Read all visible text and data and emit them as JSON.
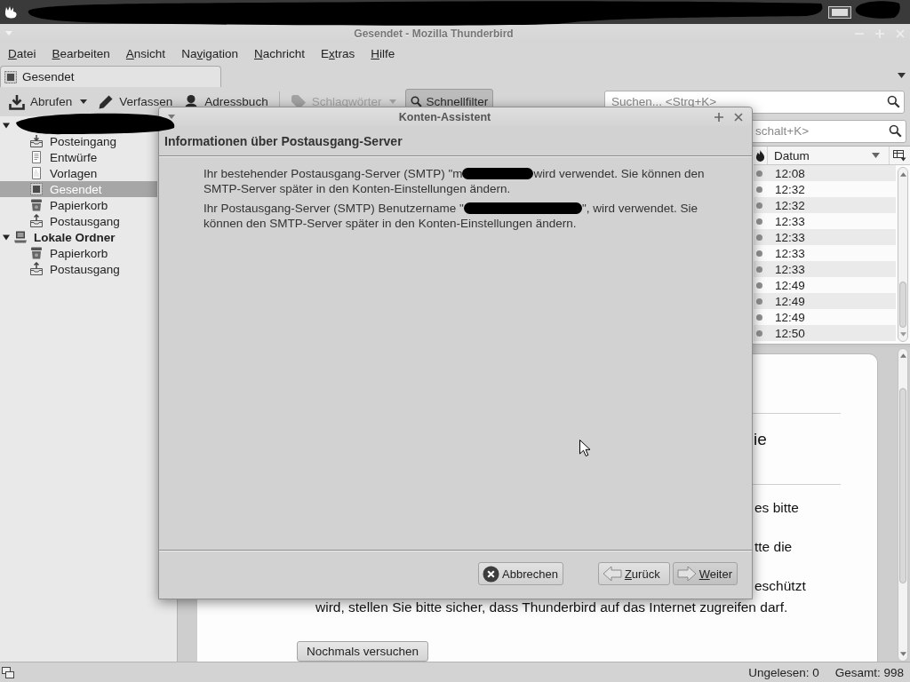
{
  "window": {
    "title": "Gesendet - Mozilla Thunderbird"
  },
  "menu": [
    {
      "key": "D",
      "post": "atei"
    },
    {
      "key": "B",
      "post": "earbeiten"
    },
    {
      "key": "A",
      "post": "nsicht"
    },
    {
      "pre": "Na",
      "key": "v",
      "post": "igation"
    },
    {
      "key": "N",
      "post": "achricht"
    },
    {
      "pre": "E",
      "key": "x",
      "post": "tras"
    },
    {
      "key": "H",
      "post": "ilfe"
    }
  ],
  "tabs": [
    {
      "label": "Gesendet",
      "selected": true
    }
  ],
  "toolbar": {
    "main": [
      {
        "kind": "download",
        "label": "Abrufen",
        "dropdown": true,
        "disabled": false,
        "pressed": false
      },
      {
        "kind": "pencil",
        "label": "Verfassen",
        "dropdown": false,
        "disabled": false,
        "pressed": false
      },
      {
        "kind": "person",
        "label": "Adressbuch",
        "dropdown": false,
        "disabled": false,
        "pressed": false
      }
    ],
    "filters": [
      {
        "kind": "tag",
        "label": "Schlagwörter",
        "dropdown": true,
        "disabled": true,
        "pressed": false
      },
      {
        "kind": "search",
        "label": "Schnellfilter",
        "dropdown": false,
        "disabled": false,
        "pressed": true
      }
    ],
    "search": {
      "placeholder": "Suchen... <Strg+K>"
    }
  },
  "folders": [
    {
      "kind": "account",
      "expanded": true,
      "selected": false,
      "children": [
        {
          "name": "Posteingang",
          "kind": "inbox",
          "selected": false
        },
        {
          "name": "Entwürfe",
          "kind": "drafts",
          "selected": false
        },
        {
          "name": "Vorlagen",
          "kind": "templates",
          "selected": false
        },
        {
          "name": "Gesendet",
          "kind": "sent",
          "selected": true
        },
        {
          "name": "Papierkorb",
          "kind": "trash",
          "selected": false
        },
        {
          "name": "Postausgang",
          "kind": "outbox",
          "selected": false
        }
      ]
    },
    {
      "kind": "local",
      "name": "Lokale Ordner",
      "expanded": true,
      "selected": false,
      "children": [
        {
          "name": "Papierkorb",
          "kind": "trash",
          "selected": false
        },
        {
          "name": "Postausgang",
          "kind": "outbox",
          "selected": false
        }
      ]
    }
  ],
  "quick_filter": {
    "search": {
      "placeholder": "schalt+K>"
    }
  },
  "message_list": {
    "date_column": {
      "label": "Datum",
      "sorted": true
    },
    "rows": [
      {
        "date": "12:08",
        "read": true,
        "selected": false
      },
      {
        "date": "12:32",
        "read": true,
        "selected": false
      },
      {
        "date": "12:32",
        "read": true,
        "selected": false
      },
      {
        "date": "12:33",
        "read": true,
        "selected": false
      },
      {
        "date": "12:33",
        "read": true,
        "selected": false
      },
      {
        "date": "12:33",
        "read": true,
        "selected": false
      },
      {
        "date": "12:33",
        "read": true,
        "selected": false
      },
      {
        "date": "12:49",
        "read": true,
        "selected": false
      },
      {
        "date": "12:49",
        "read": true,
        "selected": false
      },
      {
        "date": "12:49",
        "read": true,
        "selected": false
      },
      {
        "date": "12:50",
        "read": true,
        "selected": false
      }
    ]
  },
  "preview": {
    "blocks": [
      {
        "kind": "rule"
      },
      {
        "kind": "heading",
        "text": "ie"
      },
      {
        "kind": "rule"
      },
      {
        "kind": "fragment",
        "text": "es bitte"
      },
      {
        "kind": "fragment",
        "text": "tte die"
      },
      {
        "kind": "fragment",
        "text": "eschützt"
      },
      {
        "kind": "line",
        "text": "wird, stellen Sie bitte sicher, dass Thunderbird auf das Internet zugreifen darf."
      },
      {
        "kind": "button",
        "text": "Nochmals versuchen"
      }
    ]
  },
  "status_bar": {
    "unread": "Ungelesen: 0",
    "total": "Gesamt: 998"
  },
  "dialog": {
    "title": "Konten-Assistent",
    "heading": "Informationen über Postausgang-Server",
    "paragraphs": [
      [
        [
          {
            "kind": "text",
            "text": "Ihr bestehender Postausgang-Server (SMTP) \"m"
          },
          {
            "kind": "redaction"
          },
          {
            "kind": "text",
            "text": "wird verwendet. Sie können den"
          }
        ],
        [
          {
            "kind": "text",
            "text": "SMTP-Server später in den Konten-Einstellungen ändern."
          }
        ]
      ],
      [
        [
          {
            "kind": "text",
            "text": "Ihr Postausgang-Server (SMTP) Benutzername \""
          },
          {
            "kind": "redaction"
          },
          {
            "kind": "text",
            "text": "\", wird verwendet. Sie"
          }
        ],
        [
          {
            "kind": "text",
            "text": "können den SMTP-Server später in den Konten-Einstellungen ändern."
          }
        ]
      ]
    ],
    "buttons": [
      {
        "kind": "cancel",
        "label": "Abbrechen",
        "default": false
      },
      {
        "kind": "back",
        "key": "Z",
        "post": "urück",
        "default": false
      },
      {
        "kind": "forward",
        "key": "W",
        "post": "eiter",
        "default": true
      }
    ]
  }
}
